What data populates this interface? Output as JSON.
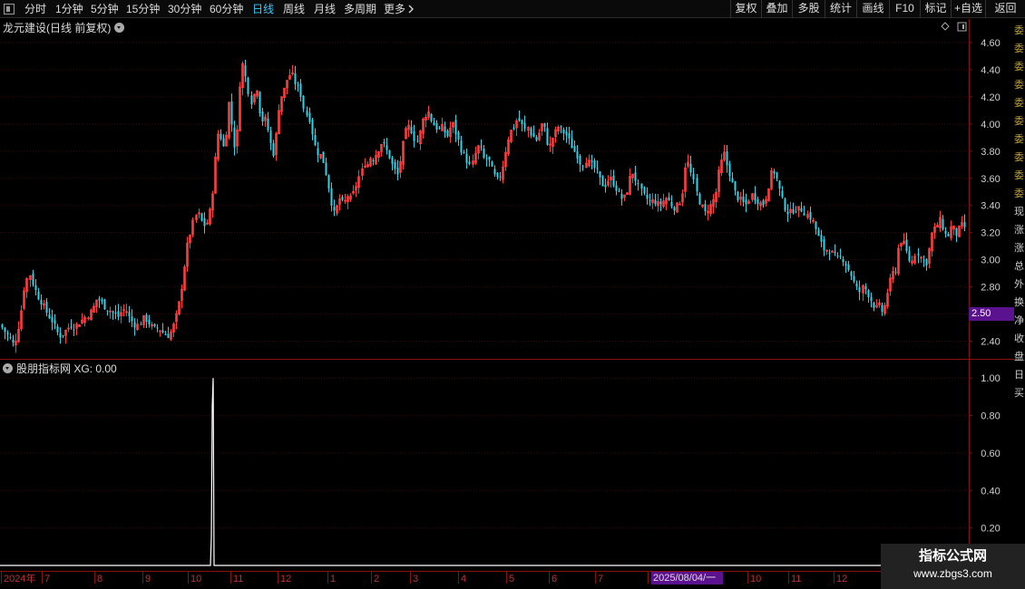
{
  "toolbar": {
    "periods": [
      "分时",
      "1分钟",
      "5分钟",
      "15分钟",
      "30分钟",
      "60分钟",
      "日线",
      "周线",
      "月线",
      "多周期",
      "更多"
    ],
    "active_period": "日线",
    "more_icon": "chevron-right-icon",
    "right_buttons": [
      "复权",
      "叠加",
      "多股",
      "统计",
      "画线",
      "F10",
      "标记",
      "+自选",
      "返回"
    ]
  },
  "kline_pane": {
    "title": "龙元建设(日线 前复权)",
    "icons": [
      "chevron-down-icon",
      "diamond-icon",
      "square-icon"
    ],
    "price_badge": "2.50",
    "up_color": "#ff3c3c",
    "down_color": "#2fd4e8"
  },
  "indicator_pane": {
    "title": "股朋指标网 XG: 0.00",
    "icon": "chevron-down-icon",
    "line_color": "#ffffff"
  },
  "right_panel": {
    "glyphs": [
      "委",
      "委",
      "委",
      "委",
      "委",
      "委",
      "委",
      "委",
      "委",
      "委",
      "现",
      "涨",
      "涨",
      "总",
      "外",
      "换",
      "净",
      "收",
      "盘",
      "日",
      "买"
    ]
  },
  "watermark": {
    "title": "指标公式网",
    "url": "www.zbgs3.com"
  },
  "date_badge": "2025/08/04/一",
  "chart_data": [
    {
      "type": "candlestick",
      "title": "龙元建设(日线 前复权)",
      "y_ticks": [
        2.4,
        2.6,
        2.8,
        3.0,
        3.2,
        3.4,
        3.6,
        3.8,
        4.0,
        4.2,
        4.4,
        4.6
      ],
      "ylim": [
        2.33,
        4.66
      ],
      "x_ticks": [
        "2024年",
        "7",
        "8",
        "9",
        "10",
        "11",
        "12",
        "1",
        "2",
        "3",
        "4",
        "5",
        "6",
        "7",
        "8",
        "9",
        "10",
        "11",
        "12"
      ],
      "price_path": [
        [
          0,
          2.52
        ],
        [
          6,
          2.46
        ],
        [
          11,
          2.42
        ],
        [
          16,
          2.36
        ],
        [
          18,
          2.45
        ],
        [
          22,
          2.55
        ],
        [
          26,
          2.78
        ],
        [
          29,
          2.84
        ],
        [
          31,
          2.92
        ],
        [
          34,
          2.86
        ],
        [
          38,
          2.78
        ],
        [
          42,
          2.72
        ],
        [
          46,
          2.68
        ],
        [
          50,
          2.62
        ],
        [
          54,
          2.58
        ],
        [
          58,
          2.54
        ],
        [
          62,
          2.47
        ],
        [
          66,
          2.44
        ],
        [
          70,
          2.46
        ],
        [
          74,
          2.49
        ],
        [
          78,
          2.52
        ],
        [
          82,
          2.5
        ],
        [
          86,
          2.53
        ],
        [
          90,
          2.55
        ],
        [
          94,
          2.58
        ],
        [
          98,
          2.6
        ],
        [
          102,
          2.64
        ],
        [
          106,
          2.71
        ],
        [
          110,
          2.7
        ],
        [
          114,
          2.66
        ],
        [
          118,
          2.64
        ],
        [
          122,
          2.62
        ],
        [
          126,
          2.6
        ],
        [
          130,
          2.58
        ],
        [
          134,
          2.62
        ],
        [
          138,
          2.64
        ],
        [
          142,
          2.58
        ],
        [
          146,
          2.54
        ],
        [
          150,
          2.51
        ],
        [
          154,
          2.53
        ],
        [
          158,
          2.57
        ],
        [
          162,
          2.55
        ],
        [
          166,
          2.51
        ],
        [
          170,
          2.49
        ],
        [
          174,
          2.5
        ],
        [
          178,
          2.47
        ],
        [
          182,
          2.45
        ],
        [
          186,
          2.44
        ],
        [
          190,
          2.49
        ],
        [
          194,
          2.58
        ],
        [
          198,
          2.7
        ],
        [
          202,
          2.88
        ],
        [
          205,
          3.06
        ],
        [
          208,
          3.15
        ],
        [
          211,
          3.24
        ],
        [
          214,
          3.3
        ],
        [
          217,
          3.35
        ],
        [
          220,
          3.31
        ],
        [
          223,
          3.26
        ],
        [
          226,
          3.25
        ],
        [
          229,
          3.29
        ],
        [
          232,
          3.4
        ],
        [
          235,
          3.58
        ],
        [
          238,
          3.84
        ],
        [
          241,
          3.98
        ],
        [
          244,
          3.86
        ],
        [
          247,
          3.82
        ],
        [
          250,
          4.0
        ],
        [
          253,
          4.22
        ],
        [
          256,
          3.91
        ],
        [
          259,
          3.82
        ],
        [
          262,
          3.98
        ],
        [
          264,
          4.28
        ],
        [
          267,
          4.45
        ],
        [
          270,
          4.36
        ],
        [
          273,
          4.26
        ],
        [
          276,
          4.16
        ],
        [
          279,
          4.2
        ],
        [
          282,
          4.3
        ],
        [
          285,
          4.12
        ],
        [
          288,
          4.02
        ],
        [
          291,
          4.05
        ],
        [
          294,
          3.98
        ],
        [
          297,
          3.89
        ],
        [
          300,
          3.76
        ],
        [
          303,
          3.84
        ],
        [
          306,
          4.08
        ],
        [
          309,
          4.2
        ],
        [
          312,
          4.22
        ],
        [
          315,
          4.31
        ],
        [
          318,
          4.35
        ],
        [
          321,
          4.38
        ],
        [
          324,
          4.32
        ],
        [
          327,
          4.28
        ],
        [
          330,
          4.25
        ],
        [
          333,
          4.18
        ],
        [
          336,
          4.06
        ],
        [
          339,
          4.08
        ],
        [
          342,
          4.0
        ],
        [
          345,
          3.88
        ],
        [
          348,
          3.8
        ],
        [
          351,
          3.78
        ],
        [
          354,
          3.76
        ],
        [
          357,
          3.7
        ],
        [
          360,
          3.6
        ],
        [
          363,
          3.5
        ],
        [
          366,
          3.38
        ],
        [
          369,
          3.32
        ],
        [
          372,
          3.42
        ],
        [
          375,
          3.46
        ],
        [
          378,
          3.4
        ],
        [
          381,
          3.44
        ],
        [
          384,
          3.48
        ],
        [
          387,
          3.44
        ],
        [
          390,
          3.5
        ],
        [
          393,
          3.56
        ],
        [
          396,
          3.62
        ],
        [
          399,
          3.66
        ],
        [
          402,
          3.72
        ],
        [
          405,
          3.7
        ],
        [
          408,
          3.76
        ],
        [
          411,
          3.74
        ],
        [
          414,
          3.78
        ],
        [
          417,
          3.82
        ],
        [
          420,
          3.86
        ],
        [
          423,
          3.84
        ],
        [
          426,
          3.8
        ],
        [
          429,
          3.76
        ],
        [
          432,
          3.7
        ],
        [
          435,
          3.66
        ],
        [
          438,
          3.62
        ],
        [
          441,
          3.72
        ],
        [
          444,
          3.84
        ],
        [
          447,
          3.94
        ],
        [
          450,
          3.98
        ],
        [
          453,
          3.96
        ],
        [
          456,
          3.9
        ],
        [
          459,
          3.86
        ],
        [
          462,
          3.92
        ],
        [
          465,
          4.02
        ],
        [
          468,
          4.06
        ],
        [
          471,
          4.1
        ],
        [
          474,
          4.04
        ],
        [
          477,
          4.0
        ],
        [
          480,
          3.98
        ],
        [
          483,
          3.95
        ],
        [
          486,
          3.98
        ],
        [
          489,
          3.96
        ],
        [
          492,
          3.9
        ],
        [
          495,
          3.94
        ],
        [
          498,
          4.02
        ],
        [
          501,
          3.96
        ],
        [
          504,
          3.9
        ],
        [
          507,
          3.84
        ],
        [
          510,
          3.78
        ],
        [
          513,
          3.76
        ],
        [
          516,
          3.7
        ],
        [
          519,
          3.68
        ],
        [
          522,
          3.74
        ],
        [
          525,
          3.82
        ],
        [
          528,
          3.84
        ],
        [
          531,
          3.78
        ],
        [
          534,
          3.72
        ],
        [
          537,
          3.76
        ],
        [
          540,
          3.7
        ],
        [
          543,
          3.64
        ],
        [
          546,
          3.6
        ],
        [
          549,
          3.58
        ],
        [
          552,
          3.64
        ],
        [
          555,
          3.72
        ],
        [
          558,
          3.84
        ],
        [
          561,
          3.92
        ],
        [
          564,
          3.96
        ],
        [
          567,
          3.98
        ],
        [
          570,
          4.04
        ],
        [
          573,
          4.02
        ],
        [
          576,
          3.98
        ],
        [
          579,
          3.95
        ],
        [
          582,
          3.98
        ],
        [
          585,
          3.92
        ],
        [
          588,
          3.9
        ],
        [
          591,
          3.88
        ],
        [
          594,
          3.94
        ],
        [
          597,
          4.0
        ],
        [
          600,
          3.96
        ],
        [
          603,
          3.86
        ],
        [
          606,
          3.84
        ],
        [
          609,
          3.9
        ],
        [
          612,
          3.94
        ],
        [
          615,
          3.98
        ],
        [
          618,
          3.96
        ],
        [
          621,
          3.94
        ],
        [
          624,
          3.92
        ],
        [
          627,
          3.88
        ],
        [
          630,
          3.84
        ],
        [
          633,
          3.8
        ],
        [
          636,
          3.78
        ],
        [
          639,
          3.72
        ],
        [
          642,
          3.7
        ],
        [
          645,
          3.74
        ],
        [
          648,
          3.72
        ],
        [
          651,
          3.7
        ],
        [
          654,
          3.68
        ],
        [
          657,
          3.66
        ],
        [
          660,
          3.6
        ],
        [
          663,
          3.56
        ],
        [
          666,
          3.54
        ],
        [
          669,
          3.58
        ],
        [
          672,
          3.6
        ],
        [
          675,
          3.58
        ],
        [
          678,
          3.54
        ],
        [
          681,
          3.5
        ],
        [
          684,
          3.46
        ],
        [
          687,
          3.44
        ],
        [
          690,
          3.48
        ],
        [
          693,
          3.55
        ],
        [
          696,
          3.66
        ],
        [
          699,
          3.62
        ],
        [
          702,
          3.56
        ],
        [
          705,
          3.52
        ],
        [
          708,
          3.48
        ],
        [
          711,
          3.46
        ],
        [
          714,
          3.44
        ],
        [
          717,
          3.42
        ],
        [
          720,
          3.44
        ],
        [
          723,
          3.42
        ],
        [
          726,
          3.4
        ],
        [
          729,
          3.42
        ],
        [
          732,
          3.44
        ],
        [
          735,
          3.46
        ],
        [
          738,
          3.42
        ],
        [
          741,
          3.4
        ],
        [
          744,
          3.38
        ],
        [
          747,
          3.4
        ],
        [
          750,
          3.44
        ],
        [
          753,
          3.52
        ],
        [
          756,
          3.74
        ],
        [
          759,
          3.7
        ],
        [
          762,
          3.62
        ],
        [
          765,
          3.56
        ],
        [
          768,
          3.48
        ],
        [
          771,
          3.42
        ],
        [
          774,
          3.38
        ],
        [
          777,
          3.34
        ],
        [
          780,
          3.38
        ],
        [
          783,
          3.4
        ],
        [
          786,
          3.44
        ],
        [
          789,
          3.5
        ],
        [
          792,
          3.64
        ],
        [
          795,
          3.72
        ],
        [
          798,
          3.78
        ],
        [
          801,
          3.7
        ],
        [
          804,
          3.64
        ],
        [
          807,
          3.56
        ],
        [
          810,
          3.5
        ],
        [
          813,
          3.46
        ],
        [
          816,
          3.44
        ],
        [
          819,
          3.42
        ],
        [
          822,
          3.4
        ],
        [
          825,
          3.44
        ],
        [
          828,
          3.48
        ],
        [
          831,
          3.46
        ],
        [
          834,
          3.44
        ],
        [
          837,
          3.42
        ],
        [
          840,
          3.4
        ],
        [
          843,
          3.44
        ],
        [
          846,
          3.52
        ],
        [
          849,
          3.62
        ],
        [
          852,
          3.66
        ],
        [
          855,
          3.62
        ],
        [
          858,
          3.54
        ],
        [
          861,
          3.46
        ],
        [
          864,
          3.4
        ],
        [
          867,
          3.36
        ],
        [
          870,
          3.34
        ],
        [
          873,
          3.36
        ],
        [
          876,
          3.38
        ],
        [
          879,
          3.36
        ],
        [
          882,
          3.38
        ],
        [
          885,
          3.36
        ],
        [
          888,
          3.34
        ],
        [
          891,
          3.32
        ],
        [
          894,
          3.3
        ],
        [
          897,
          3.26
        ],
        [
          900,
          3.2
        ],
        [
          903,
          3.14
        ],
        [
          906,
          3.1
        ],
        [
          909,
          3.06
        ],
        [
          912,
          3.08
        ],
        [
          915,
          3.06
        ],
        [
          918,
          3.04
        ],
        [
          921,
          3.02
        ],
        [
          924,
          3.0
        ],
        [
          927,
          3.02
        ],
        [
          930,
          3.0
        ],
        [
          933,
          2.96
        ],
        [
          936,
          2.92
        ],
        [
          939,
          2.88
        ],
        [
          942,
          2.82
        ],
        [
          945,
          2.78
        ],
        [
          948,
          2.76
        ],
        [
          951,
          2.8
        ],
        [
          954,
          2.78
        ],
        [
          957,
          2.74
        ],
        [
          960,
          2.7
        ],
        [
          963,
          2.66
        ],
        [
          966,
          2.64
        ],
        [
          969,
          2.66
        ],
        [
          972,
          2.62
        ],
        [
          975,
          2.66
        ],
        [
          978,
          2.76
        ],
        [
          981,
          2.84
        ],
        [
          984,
          2.9
        ],
        [
          987,
          2.92
        ],
        [
          990,
          3.08
        ],
        [
          993,
          3.14
        ],
        [
          996,
          3.12
        ],
        [
          999,
          3.06
        ],
        [
          1002,
          3.0
        ],
        [
          1005,
          2.98
        ],
        [
          1008,
          3.04
        ],
        [
          1011,
          3.06
        ],
        [
          1014,
          3.02
        ],
        [
          1017,
          3.0
        ],
        [
          1020,
          2.96
        ],
        [
          1023,
          3.04
        ],
        [
          1026,
          3.18
        ],
        [
          1029,
          3.22
        ],
        [
          1032,
          3.24
        ],
        [
          1035,
          3.3
        ],
        [
          1038,
          3.26
        ],
        [
          1041,
          3.2
        ],
        [
          1044,
          3.16
        ],
        [
          1047,
          3.22
        ],
        [
          1050,
          3.26
        ],
        [
          1053,
          3.18
        ],
        [
          1056,
          3.2
        ],
        [
          1059,
          3.26
        ],
        [
          1062,
          3.24
        ]
      ]
    },
    {
      "type": "line",
      "title": "股朋指标网 XG: 0.00",
      "series": [
        {
          "name": "XG",
          "x": [
            0,
            232,
            233,
            234,
            235,
            236,
            1062
          ],
          "values": [
            0,
            0,
            0.15,
            0.85,
            1.0,
            0,
            0
          ]
        }
      ],
      "y_ticks": [
        0.2,
        0.4,
        0.6,
        0.8,
        1.0
      ],
      "ylim": [
        0,
        1.03
      ]
    }
  ]
}
